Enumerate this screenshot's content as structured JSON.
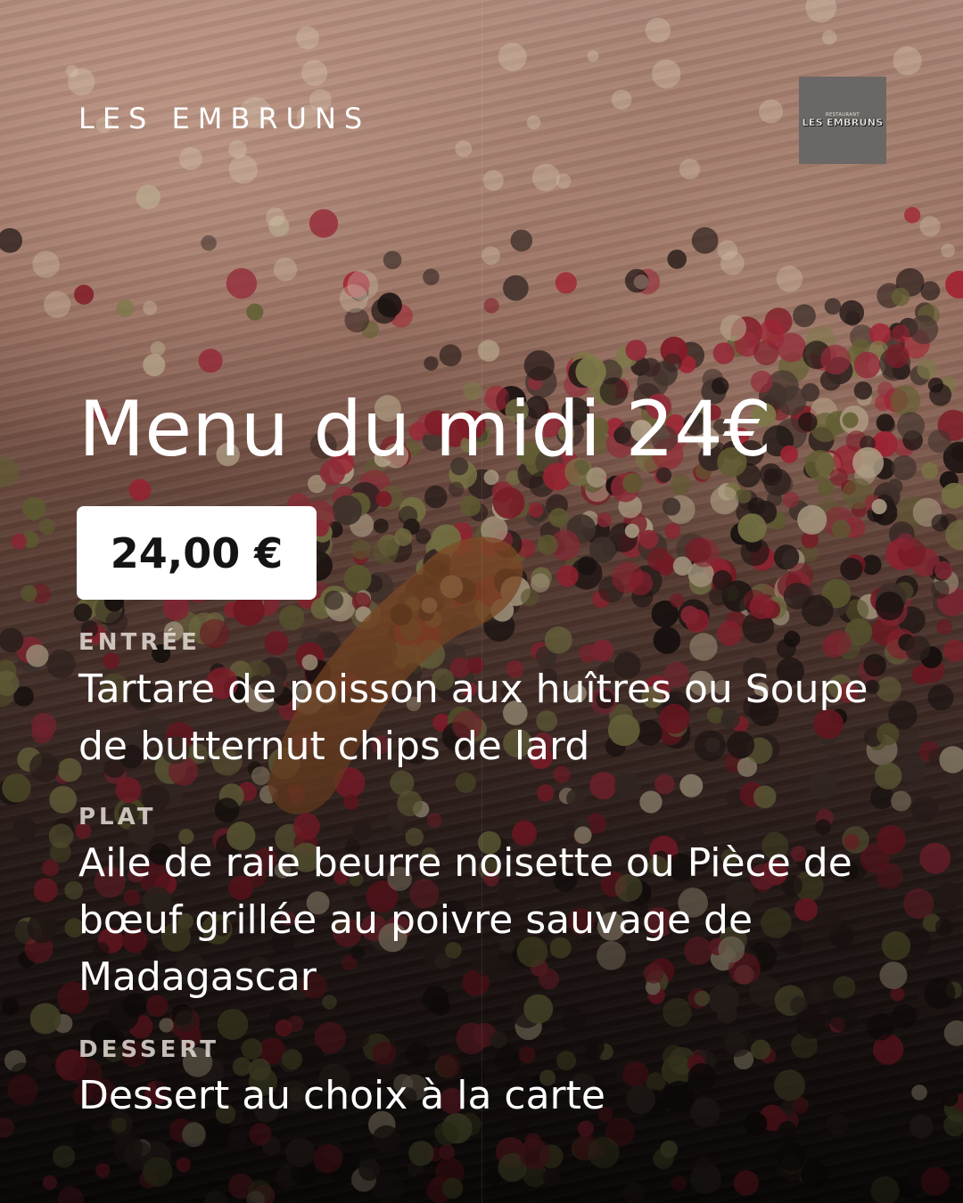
{
  "brand": {
    "name": "LES EMBRUNS",
    "logo_small_text": "RESTAURANT",
    "logo_text": "LES EMBRUNS"
  },
  "menu": {
    "title": "Menu du midi 24€",
    "price": "24,00 €",
    "sections": [
      {
        "label": "ENTRÉE",
        "text": "Tartare de poisson aux huîtres ou Soupe de butternut chips de lard"
      },
      {
        "label": "PLAT",
        "text": "Aile de raie beurre noisette ou Pièce de bœuf grillée au poivre sauvage de Madagascar"
      },
      {
        "label": "DESSERT",
        "text": "Dessert au choix à la carte"
      }
    ]
  },
  "colors": {
    "text": "#ffffff",
    "price_badge_bg": "#ffffff",
    "price_text": "#141414",
    "label_text": "#ebe4de",
    "logo_bg": "#6b6764"
  },
  "background": {
    "scene": "peppercorns-on-wooden-table"
  }
}
